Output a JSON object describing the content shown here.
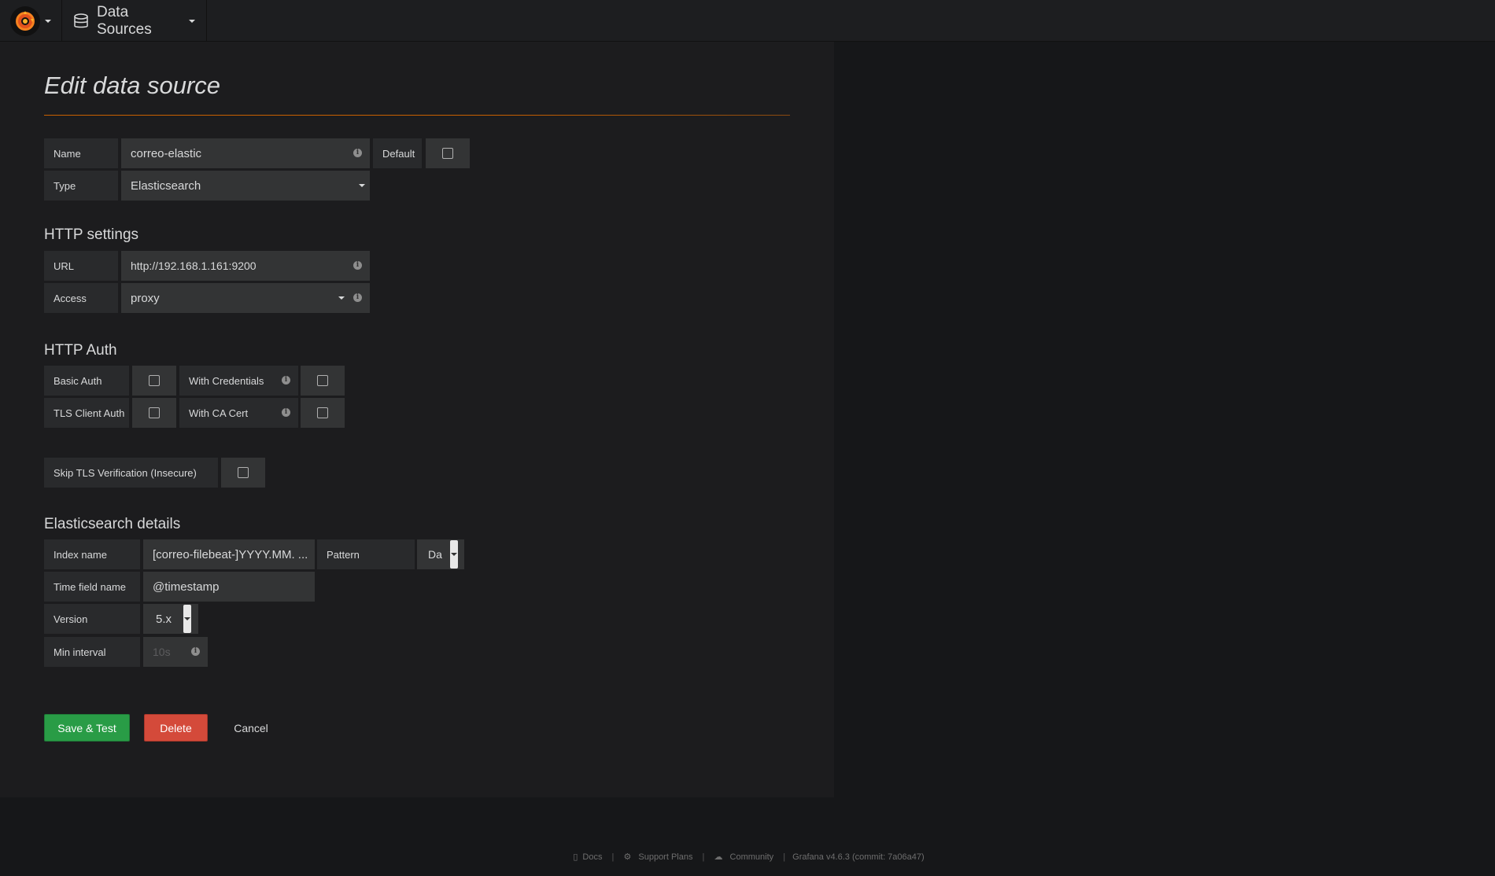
{
  "nav": {
    "section_label": "Data Sources"
  },
  "page": {
    "title": "Edit data source"
  },
  "basic": {
    "name_label": "Name",
    "name_value": "correo-elastic",
    "default_label": "Default",
    "type_label": "Type",
    "type_value": "Elasticsearch"
  },
  "http": {
    "heading": "HTTP settings",
    "url_label": "URL",
    "url_value": "http://192.168.1.161:9200",
    "access_label": "Access",
    "access_value": "proxy"
  },
  "auth": {
    "heading": "HTTP Auth",
    "basic_auth_label": "Basic Auth",
    "with_credentials_label": "With Credentials",
    "tls_client_auth_label": "TLS Client Auth",
    "with_ca_cert_label": "With CA Cert",
    "skip_tls_label": "Skip TLS Verification (Insecure)"
  },
  "es": {
    "heading": "Elasticsearch details",
    "index_label": "Index name",
    "index_value": "[correo-filebeat-]YYYY.MM. ...",
    "pattern_label": "Pattern",
    "pattern_value": "Da",
    "time_field_label": "Time field name",
    "time_field_value": "@timestamp",
    "version_label": "Version",
    "version_value": "5.x",
    "min_interval_label": "Min interval",
    "min_interval_placeholder": "10s"
  },
  "actions": {
    "save_label": "Save & Test",
    "delete_label": "Delete",
    "cancel_label": "Cancel"
  },
  "footer": {
    "docs": "Docs",
    "support": "Support Plans",
    "community": "Community",
    "version": "Grafana v4.6.3 (commit: 7a06a47)",
    "separator": "|"
  },
  "colors": {
    "accent": "#c96000",
    "save": "#299c46",
    "delete": "#d44a3a"
  }
}
